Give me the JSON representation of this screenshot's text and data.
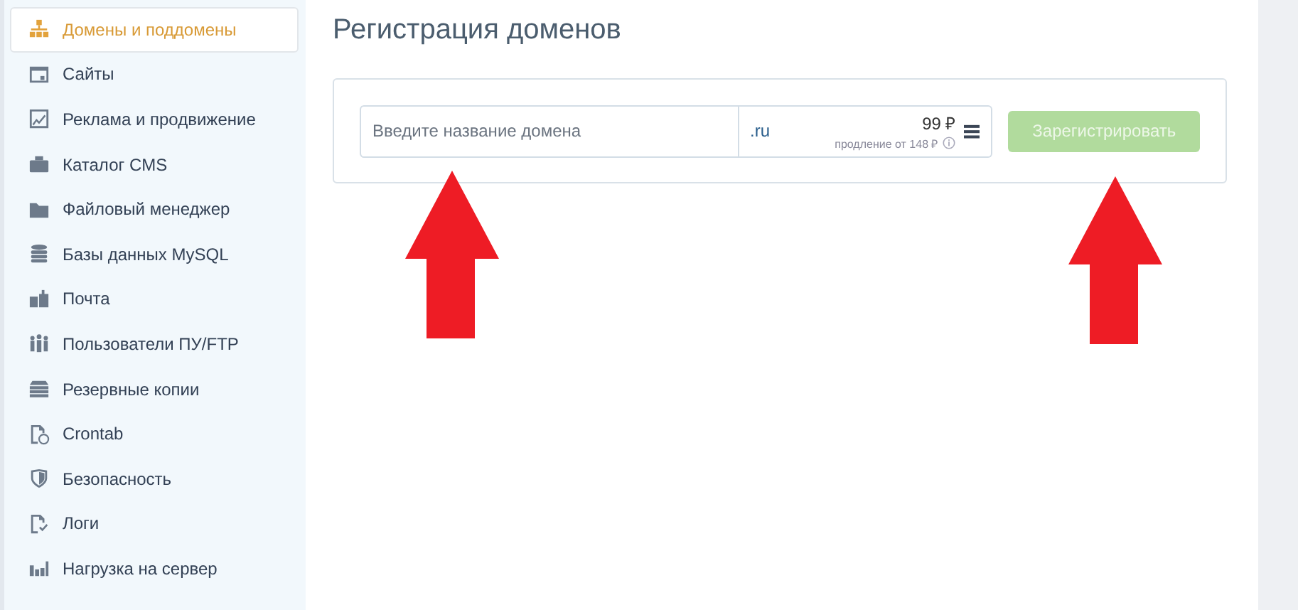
{
  "sidebar": {
    "items": [
      {
        "label": "Домены и поддомены",
        "selected": true
      },
      {
        "label": "Сайты",
        "selected": false
      },
      {
        "label": "Реклама и продвижение",
        "selected": false
      },
      {
        "label": "Каталог CMS",
        "selected": false
      },
      {
        "label": "Файловый менеджер",
        "selected": false
      },
      {
        "label": "Базы данных MySQL",
        "selected": false
      },
      {
        "label": "Почта",
        "selected": false
      },
      {
        "label": "Пользователи ПУ/FTP",
        "selected": false
      },
      {
        "label": "Резервные копии",
        "selected": false
      },
      {
        "label": "Crontab",
        "selected": false
      },
      {
        "label": "Безопасность",
        "selected": false
      },
      {
        "label": "Логи",
        "selected": false
      },
      {
        "label": "Нагрузка на сервер",
        "selected": false
      }
    ]
  },
  "page": {
    "title": "Регистрация доменов"
  },
  "form": {
    "domain_placeholder": "Введите название домена",
    "zone": ".ru",
    "price": "99 ₽",
    "renewal": "продление от 148 ₽",
    "register_button": {
      "label": "Зарегистрировать",
      "disabled": true
    }
  },
  "annotations": [
    {
      "kind": "arrow"
    },
    {
      "kind": "arrow"
    }
  ]
}
